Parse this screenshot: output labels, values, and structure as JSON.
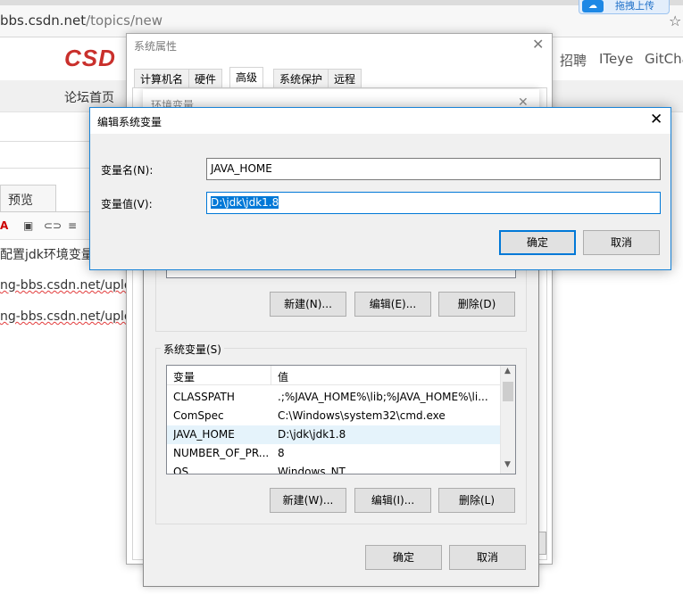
{
  "browser": {
    "url_host": "bbs.csdn.net",
    "url_path": "/topics/new",
    "upload_widget_label": "拖拽上传",
    "upload_icon": "cloud-icon",
    "star_icon": "star-icon"
  },
  "site": {
    "logo": "CSDN",
    "logo_visible": "CSD",
    "top_nav": [
      "招聘",
      "ITeye",
      "GitCha"
    ],
    "forum_home": "论坛首页"
  },
  "editor": {
    "preview_tab": "预览",
    "line1": "配置jdk环境变量",
    "line2": "ng-bbs.csdn.net/uplo",
    "line3": "ng-bbs.csdn.net/uplo"
  },
  "system_properties": {
    "title": "系统属性",
    "tabs": [
      "计算机名",
      "硬件",
      "高级",
      "系统保护",
      "远程"
    ],
    "active_tab": "高级"
  },
  "environment_variables": {
    "title": "环境变量",
    "user_buttons": {
      "new": "新建(N)...",
      "edit": "编辑(E)...",
      "delete": "删除(D)"
    },
    "system_group_label": "系统变量(S)",
    "columns": {
      "name": "变量",
      "value": "值"
    },
    "rows": [
      {
        "name": "CLASSPATH",
        "value": ".;%JAVA_HOME%\\lib;%JAVA_HOME%\\li..."
      },
      {
        "name": "ComSpec",
        "value": "C:\\Windows\\system32\\cmd.exe"
      },
      {
        "name": "JAVA_HOME",
        "value": "D:\\jdk\\jdk1.8"
      },
      {
        "name": "NUMBER_OF_PR...",
        "value": "8"
      },
      {
        "name": "OS",
        "value": "Windows_NT"
      }
    ],
    "selected_row": "JAVA_HOME",
    "system_buttons": {
      "new": "新建(W)...",
      "edit": "编辑(I)...",
      "delete": "删除(L)"
    },
    "ok": "确定",
    "cancel": "取消"
  },
  "edit_variable_dialog": {
    "title": "编辑系统变量",
    "name_label": "变量名(N):",
    "name_value": "JAVA_HOME",
    "value_label": "变量值(V):",
    "value_value": "D:\\jdk\\jdk1.8",
    "ok": "确定",
    "cancel": "取消",
    "accent_color": "#0078d7"
  }
}
